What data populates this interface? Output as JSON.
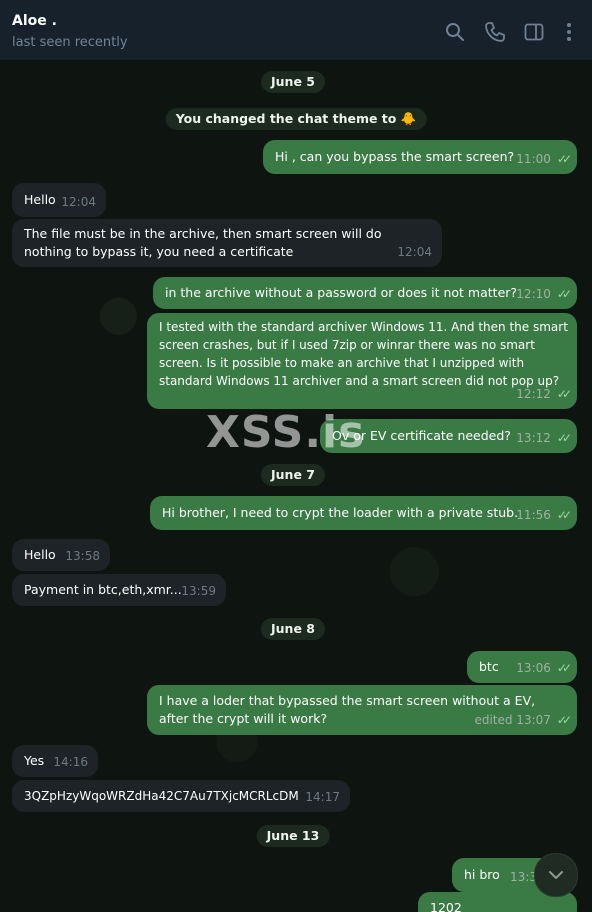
{
  "header": {
    "title": "Aloe .",
    "status": "last seen recently",
    "icons": [
      "search-icon",
      "phone-icon",
      "sidebar-toggle-icon",
      "more-vert-icon"
    ]
  },
  "chat": {
    "dates": [
      "June 5",
      "June 7",
      "June 8",
      "June 13"
    ],
    "service": "You changed the chat theme to 🐥",
    "messages": [
      {
        "text": "Hi , can you bypass the smart screen?",
        "time": "11:00"
      },
      {
        "text": "Hello",
        "time": "12:04"
      },
      {
        "text": "The file must be in the archive, then smart screen will do nothing to bypass it, you need a certificate",
        "time": "12:04"
      },
      {
        "text": "in the archive without a password or does it not matter?",
        "time": "12:10"
      },
      {
        "text": "I tested with the standard archiver Windows 11. And then the smart screen crashes, but if I used 7zip or winrar there was no smart screen. Is it possible to make an archive that I unzipped with standard Windows 11 archiver and a smart screen did not pop up?",
        "time": "12:12"
      },
      {
        "text": "Ov or EV certificate needed?",
        "time": "13:12"
      },
      {
        "text": "Hi brother, I need to crypt the loader with a private stub.",
        "time": "11:56"
      },
      {
        "text": "Hello",
        "time": "13:58"
      },
      {
        "text": "Payment in btc,eth,xmr...",
        "time": "13:59"
      },
      {
        "text": "btc",
        "time": "13:06"
      },
      {
        "text": "I have a loder that bypassed the smart screen without a EV, after the crypt will it work?",
        "time": "edited 13:07"
      },
      {
        "text": "Yes",
        "time": "14:16"
      },
      {
        "text": "3QZpHzyWqoWRZdHa42C7Au7TXjcMCRLcDM",
        "time": "14:17"
      },
      {
        "text": "hi bro",
        "time": "13:3"
      },
      {
        "text": "1202",
        "time": ""
      }
    ],
    "watermark": "XSS.is"
  },
  "colors": {
    "header_bg": "#17212b",
    "incoming_bubble": "#1d2326",
    "outgoing_bubble": "#3a7a44",
    "read_checks": "#9fd6a6"
  }
}
